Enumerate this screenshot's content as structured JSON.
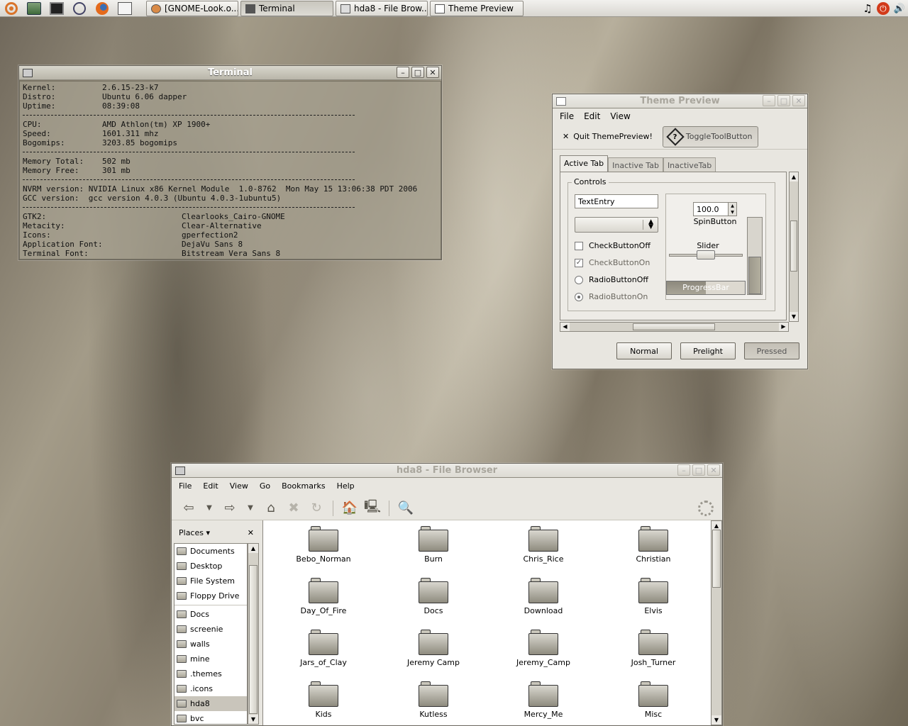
{
  "panel": {
    "launchers": [
      "ubuntu-menu-icon",
      "folder-icon",
      "terminal-icon",
      "network-icon",
      "firefox-icon",
      "mail-icon"
    ],
    "tasks": [
      {
        "label": "[GNOME-Look.o...",
        "active": false
      },
      {
        "label": "Terminal",
        "active": true
      },
      {
        "label": "hda8 - File Brow...",
        "active": false
      },
      {
        "label": "Theme Preview",
        "active": false
      }
    ],
    "tray": {
      "music": "♫",
      "power": "⏻",
      "volume": "🔊"
    }
  },
  "terminal": {
    "title": "Terminal",
    "block1": [
      {
        "k": "Kernel:",
        "v": "2.6.15-23-k7"
      },
      {
        "k": "Distro:",
        "v": "Ubuntu 6.06 dapper"
      },
      {
        "k": "Uptime:",
        "v": "08:39:08"
      }
    ],
    "block2": [
      {
        "k": "CPU:",
        "v": "AMD Athlon(tm) XP 1900+"
      },
      {
        "k": "Speed:",
        "v": "1601.311 mhz"
      },
      {
        "k": "Bogomips:",
        "v": "3203.85 bogomips"
      }
    ],
    "block3": [
      {
        "k": "Memory Total:",
        "v": "502 mb"
      },
      {
        "k": "Memory Free:",
        "v": "301 mb"
      }
    ],
    "block4": [
      "NVRM version: NVIDIA Linux x86 Kernel Module  1.0-8762  Mon May 15 13:06:38 PDT 2006",
      "GCC version:  gcc version 4.0.3 (Ubuntu 4.0.3-1ubuntu5)"
    ],
    "block5": [
      {
        "k": "GTK2:",
        "v": "Clearlooks_Cairo-GNOME"
      },
      {
        "k": "Metacity:",
        "v": "Clear-Alternative"
      },
      {
        "k": "Icons:",
        "v": "gperfection2"
      },
      {
        "k": "Application Font:",
        "v": "DejaVu Sans 8"
      },
      {
        "k": "Terminal Font:",
        "v": "Bitstream Vera Sans 8"
      }
    ]
  },
  "theme_preview": {
    "title": "Theme Preview",
    "menu": [
      "File",
      "Edit",
      "View"
    ],
    "quit_label": "Quit ThemePreview!",
    "toggle_label": "ToggleToolButton",
    "tabs": [
      "Active Tab",
      "Inactive Tab",
      "InactiveTab"
    ],
    "controls_label": "Controls",
    "entry_value": "TextEntry",
    "checks": [
      {
        "label": "CheckButtonOff",
        "checked": false
      },
      {
        "label": "CheckButtonOn",
        "checked": true
      }
    ],
    "radios": [
      {
        "label": "RadioButtonOff",
        "checked": false
      },
      {
        "label": "RadioButtonOn",
        "checked": true
      }
    ],
    "spin_value": "100.0",
    "spin_label": "SpinButton",
    "slider_label": "Slider",
    "slider_value": 0.5,
    "progress_label": "ProgressBar",
    "progress_value": 0.5,
    "buttons": [
      "Normal",
      "Prelight",
      "Pressed"
    ]
  },
  "file_browser": {
    "title": "hda8 - File Browser",
    "menu": [
      "File",
      "Edit",
      "View",
      "Go",
      "Bookmarks",
      "Help"
    ],
    "places_label": "Places",
    "places": [
      {
        "label": "Documents",
        "group": 1
      },
      {
        "label": "Desktop",
        "group": 1
      },
      {
        "label": "File System",
        "group": 1
      },
      {
        "label": "Floppy Drive",
        "group": 1
      },
      {
        "label": "Docs",
        "group": 2
      },
      {
        "label": "screenie",
        "group": 2
      },
      {
        "label": "walls",
        "group": 2
      },
      {
        "label": "mine",
        "group": 2
      },
      {
        "label": ".themes",
        "group": 2
      },
      {
        "label": ".icons",
        "group": 2
      },
      {
        "label": "hda8",
        "group": 2,
        "selected": true
      },
      {
        "label": "bvc",
        "group": 2
      }
    ],
    "folders": [
      "Bebo_Norman",
      "Burn",
      "Chris_Rice",
      "Christian",
      "Day_Of_Fire",
      "Docs",
      "Download",
      "Elvis",
      "Jars_of_Clay",
      "Jeremy Camp",
      "Jeremy_Camp",
      "Josh_Turner",
      "Kids",
      "Kutless",
      "Mercy_Me",
      "Misc"
    ]
  }
}
